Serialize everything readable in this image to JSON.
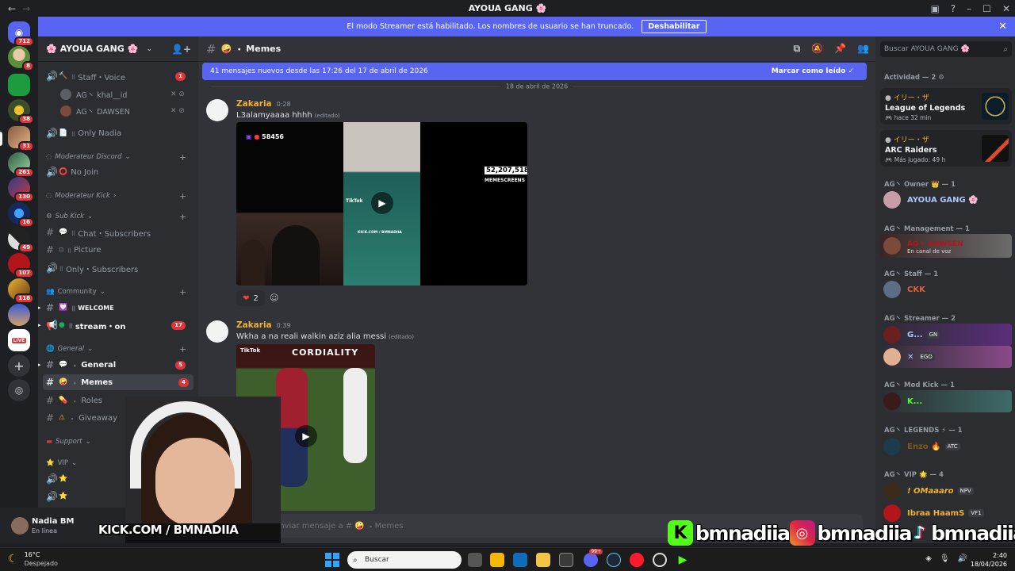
{
  "window": {
    "title": "AYOUA GANG 🌸"
  },
  "banner": {
    "text": "El modo Streamer está habilitado. Los nombres de usuario se han truncado.",
    "disable_label": "Deshabilitar"
  },
  "rail": {
    "badges": [
      "712",
      "8",
      "38",
      "31",
      "261",
      "130",
      "16",
      "49",
      "107",
      "118"
    ],
    "live_label": "LIVE"
  },
  "guild": {
    "name": "AYOUA GANG",
    "flower": "🌸"
  },
  "sidebar": {
    "staff_voice": "Staff・Voice",
    "staff_voice_badge": "1",
    "voice_users": [
      {
        "name": "AG丶 khal__id"
      },
      {
        "name": "AG丶 DAWSEN"
      }
    ],
    "only_nadia": "Only Nadia",
    "cat_mod_discord": "Moderateur Discord",
    "no_join": "No Join",
    "cat_mod_kick": "Moderateur Kick",
    "cat_sub_kick": "Sub Kick",
    "chat_subs": "Chat・Subscribers",
    "picture": "Picture",
    "only_subs": "Only・Subscribers",
    "cat_community": "Community",
    "welcome": "WELCOME",
    "stream_on": "stream・on",
    "stream_on_badge": "17",
    "cat_general": "General",
    "general": "General",
    "general_badge": "5",
    "memes": "Memes",
    "memes_badge": "4",
    "roles": "Roles",
    "giveaway": "Giveaway",
    "cat_support": "Support",
    "cat_vip": "VIP"
  },
  "user_panel": {
    "name": "Nadia BM",
    "status": "En línea"
  },
  "chat": {
    "channel_name": "Memes",
    "new_messages": "41 mensajes nuevos desde las 17:26 del 17 de abril de 2026",
    "mark_read": "Marcar como leído",
    "date_divider": "18 de abril de 2026",
    "messages": [
      {
        "author": "Zakaria",
        "time": "0:28",
        "text": "L3alamyaaaa hhhh",
        "edited": "(editado)",
        "overlay_count": "58456",
        "overlay_views": "52,207,518",
        "overlay_caption": "MEMESCREENS",
        "overlay_tiktok": "TikTok",
        "overlay_kick": "KICK.COM / BMNADIIA",
        "reaction_count": "2"
      },
      {
        "author": "Zakaria",
        "time": "0:39",
        "text": "Wkha a na reali walkin aziz alia messi",
        "edited": "(editado)",
        "overlay_tiktok": "TikTok",
        "overlay_banner": "CORDIALITY"
      }
    ],
    "composer_placeholder": "Enviar mensaje a #",
    "composer_channel": "Memes"
  },
  "members": {
    "search_placeholder": "Buscar AYOUA GANG 🌸",
    "activity_header": "Actividad — 2",
    "activities": [
      {
        "user": "イリー・ザ",
        "game": "League of Legends",
        "time": "hace 32 min"
      },
      {
        "user": "イリー・ザ",
        "game": "ARC Raiders",
        "time": "Más jugado: 49 h"
      }
    ],
    "owner_header": "AG丶 Owner 👑 — 1",
    "owner_name": "AYOUA GANG 🌸",
    "management_header": "AG丶 Management — 1",
    "management_name": "AG丶 DAWSEN",
    "management_status": "En canal de voz",
    "staff_header": "AG丶 Staff — 1",
    "staff_name": "CKK",
    "streamer_header": "AG丶 Streamer — 2",
    "streamer_tag1": "GN",
    "streamer_tag2": "EGO",
    "modkick_header": "AG丶 Mod Kick — 1",
    "modkick_name": "K...",
    "legends_header": "AG丶 LEGENDS ⚡ — 1",
    "legends_name": "Enzo 🔥",
    "legends_tag": "ATC",
    "vip_header": "AG丶 VIP 🌟 — 4",
    "vip1_name": "! OMaaaro",
    "vip1_tag": "NPV",
    "vip2_name": "Ibraa HaamS",
    "vip2_tag": "VF1"
  },
  "overlay": {
    "kick_text": "KICK.COM / BMNADIIA",
    "kick_handle": "bmnadiia",
    "ig_handle": "bmnadiia",
    "tt_handle": "bmnadiia"
  },
  "taskbar": {
    "temp": "16°C",
    "weather": "Despejado",
    "search_placeholder": "Buscar",
    "time": "2:40",
    "date": "18/04/2026",
    "discord_badge": "99+"
  },
  "colors": {
    "blurple": "#5865f2",
    "kick_green": "#53fc18",
    "mention_red": "#da373c",
    "author_gold": "#f0b232"
  }
}
